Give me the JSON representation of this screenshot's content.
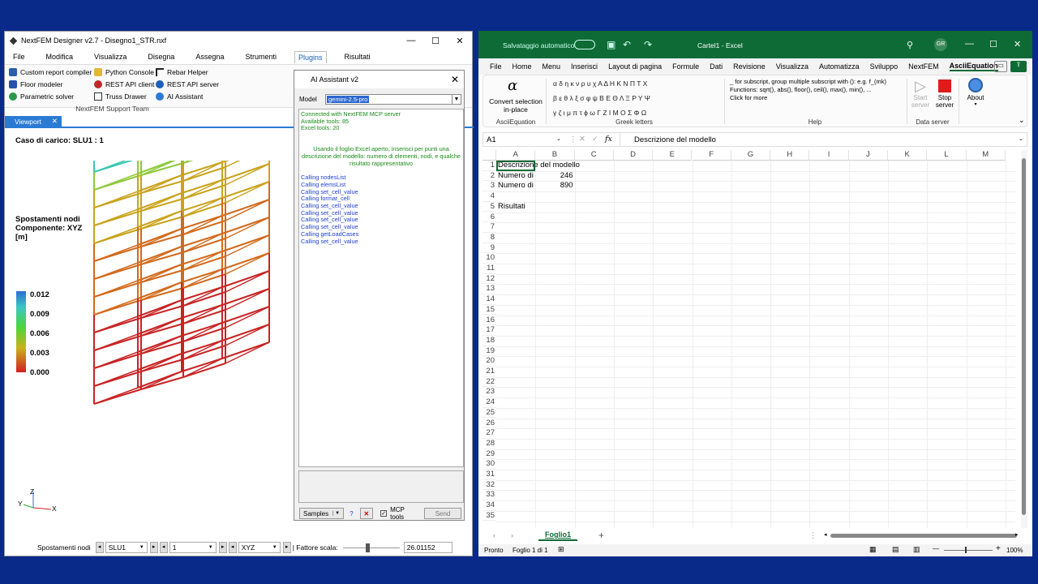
{
  "nextfem": {
    "title": "NextFEM Designer v2.7 - Disegno1_STR.nxf",
    "menu": [
      "File",
      "Modifica",
      "Visualizza",
      "Disegna",
      "Assegna",
      "Strumenti",
      "Plugins",
      "Risultati"
    ],
    "active_menu": "Plugins",
    "ribbon": {
      "custom_report": "Custom report compiler",
      "python_console": "Python Console",
      "rebar_helper": "Rebar Helper",
      "floor_modeler": "Floor modeler",
      "rest_client": "REST API client",
      "rest_server": "REST API server",
      "parametric_solver": "Parametric solver",
      "truss_drawer": "Truss Drawer",
      "ai_assistant": "AI Assistant",
      "team": "NextFEM Support Team"
    },
    "viewport_tab": "Viewport",
    "load_case": "Caso di carico: SLU1 : 1",
    "legend_title": [
      "Spostamenti nodi",
      "Componente: XYZ",
      "[m]"
    ],
    "scale_values": [
      "0.012",
      "0.009",
      "0.006",
      "0.003",
      "0.000"
    ],
    "axis": {
      "z": "Z",
      "y": "Y",
      "x": "X"
    },
    "status": {
      "result": "Spostamenti nodi",
      "case": "SLU1",
      "step": "1",
      "component": "XYZ",
      "scale_label": "| Fattore scala:",
      "scale_value": "26.01152"
    }
  },
  "ai": {
    "title": "AI Assistant v2",
    "model_label": "Model",
    "model_value": "gemini-2.5-pro",
    "log_connect": [
      "Connected with NextFEM MCP server",
      "Available tools: 85",
      "Excel tools: 20"
    ],
    "log_prompt": "Usando il foglio Excel aperto, inserisci per punti una descrizione del modello: numero di elementi, nodi, e qualche risultato rappresentativo",
    "log_calls": [
      "Calling nodesList",
      "Calling elemsList",
      "Calling set_cell_value",
      "Calling format_cell",
      "Calling set_cell_value",
      "Calling set_cell_value",
      "Calling set_cell_value",
      "Calling set_cell_value",
      "Calling getLoadCases",
      "Calling set_cell_value"
    ],
    "samples": "Samples",
    "help": "?",
    "mcp_tools": "MCP tools",
    "send": "Send"
  },
  "excel": {
    "autosave": "Salvataggio automatico",
    "title": "Cartel1 - Excel",
    "user": "GR",
    "menu": [
      "File",
      "Home",
      "Menu",
      "Inserisci",
      "Layout di pagina",
      "Formule",
      "Dati",
      "Revisione",
      "Visualizza",
      "Automatizza",
      "Sviluppo",
      "NextFEM",
      "AsciiEquation"
    ],
    "active_menu": "AsciiEquation",
    "ribbon": {
      "convert": [
        "Convert selection",
        "in-place"
      ],
      "group_ascii": "AsciiEquation",
      "greek_rows": [
        "α δ η κ ν ρ υ χ Α Δ Η Κ Ν Π Τ Χ",
        "β ε θ λ ξ σ φ ψ Β Ε Θ Λ Ξ Ρ Υ Ψ",
        "γ ζ ι μ π τ ϕ ω Γ Ζ Ι Μ Ο Σ Φ Ω"
      ],
      "group_greek": "Greek letters",
      "help_lines": [
        "_ for subscript, group multiple subscript with (): e.g. f_(mk)",
        "Functions: sqrt(), abs(), floor(), ceil(), max(), min(), ...",
        "Click for more"
      ],
      "group_help": "Help",
      "start_server": [
        "Start",
        "server"
      ],
      "stop_server": [
        "Stop",
        "server"
      ],
      "group_server": "Data server",
      "about": "About"
    },
    "name_box": "A1",
    "formula": "Descrizione del modello",
    "columns": [
      "A",
      "B",
      "C",
      "D",
      "E",
      "F",
      "G",
      "H",
      "I",
      "J",
      "K",
      "L",
      "M"
    ],
    "cells": {
      "A1": "Descrizione del modello",
      "A2": "Numero di",
      "B2": "246",
      "A3": "Numero di",
      "B3": "890",
      "A5": "Risultati"
    },
    "sheet": "Foglio1",
    "status_ready": "Pronto",
    "status_sheet": "Foglio 1 di 1",
    "zoom": "100%"
  },
  "colors": {
    "excel_green": "#0e6b35",
    "nf_blue": "#2b7bd6"
  }
}
